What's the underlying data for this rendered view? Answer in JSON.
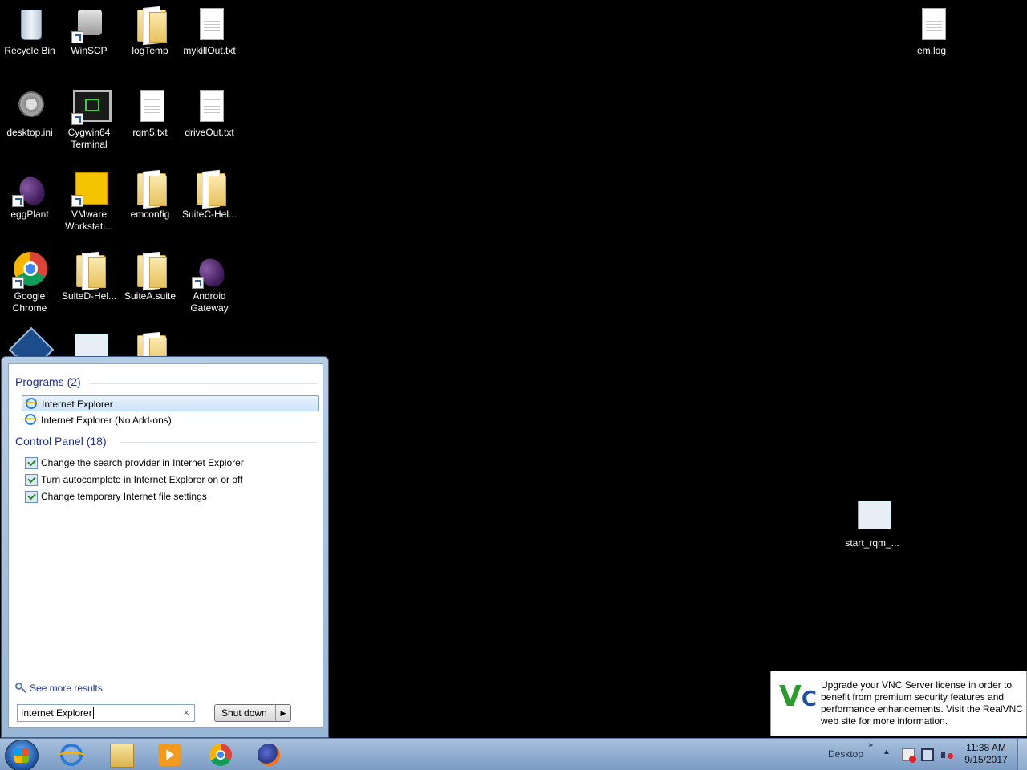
{
  "desktop": {
    "icons": [
      {
        "label": "Recycle Bin"
      },
      {
        "label": "WinSCP"
      },
      {
        "label": "logTemp"
      },
      {
        "label": "mykillOut.txt"
      },
      {
        "label": "desktop.ini"
      },
      {
        "label": "Cygwin64 Terminal"
      },
      {
        "label": "rqm5.txt"
      },
      {
        "label": "driveOut.txt"
      },
      {
        "label": "eggPlant"
      },
      {
        "label": "VMware Workstati..."
      },
      {
        "label": "emconfig"
      },
      {
        "label": "SuiteC-Hel..."
      },
      {
        "label": "Google Chrome"
      },
      {
        "label": "SuiteD-Hel..."
      },
      {
        "label": "SuiteA.suite"
      },
      {
        "label": "Android Gateway"
      },
      {
        "label": "em.log"
      },
      {
        "label": "start_rqm_..."
      }
    ]
  },
  "start_menu": {
    "programs_header": "Programs (2)",
    "programs": [
      {
        "label": "Internet Explorer",
        "selected": true
      },
      {
        "label": "Internet Explorer (No Add-ons)",
        "selected": false
      }
    ],
    "control_panel_header": "Control Panel (18)",
    "control_panel": [
      {
        "label": "Change the search provider in Internet Explorer"
      },
      {
        "label": "Turn autocomplete in Internet Explorer on or off"
      },
      {
        "label": "Change temporary Internet file settings"
      }
    ],
    "see_more": "See more results",
    "search_value": "Internet Explorer",
    "clear_glyph": "×",
    "shutdown_label": "Shut down",
    "shutdown_arrow": "▶"
  },
  "vnc_popup": {
    "logo_v": "V",
    "logo_n": "n",
    "logo_c": "C",
    "message": "Upgrade your VNC Server license in order to benefit from premium security features and performance enhancements. Visit the RealVNC web site for more information."
  },
  "taskbar": {
    "pinned": [
      "start-orb",
      "internet-explorer",
      "windows-explorer",
      "windows-media-player",
      "google-chrome",
      "firefox"
    ],
    "desktop_label": "Desktop",
    "chevron": "»",
    "tray_expand": "▲",
    "time": "11:38 AM",
    "date": "9/15/2017"
  },
  "colors": {
    "desktop_bg": "#000000",
    "group_header": "#1e3287",
    "taskbar": "#8fadd2"
  }
}
